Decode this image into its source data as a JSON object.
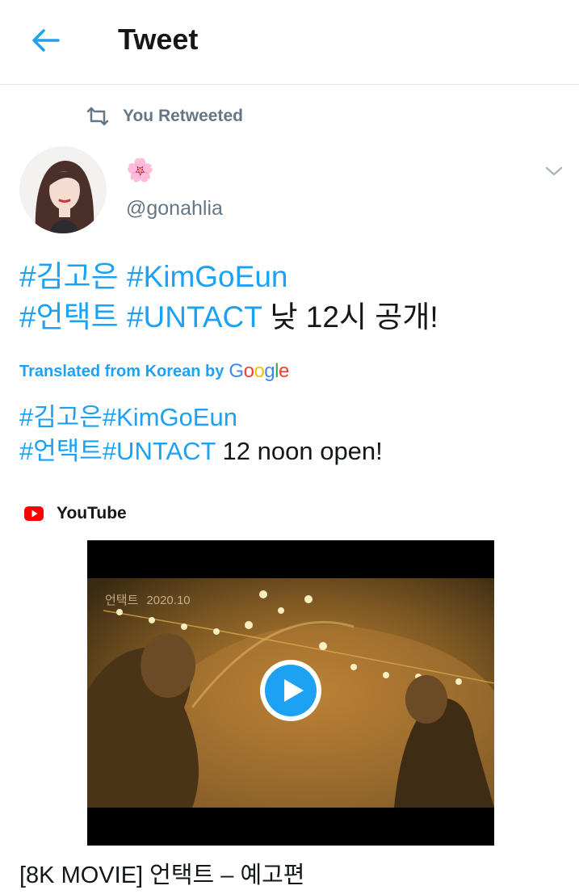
{
  "header": {
    "title": "Tweet",
    "back_icon": "arrow-left-icon"
  },
  "retweet": {
    "label": "You Retweeted",
    "icon": "retweet-icon"
  },
  "author": {
    "display_name": "🌸",
    "handle": "@gonahlia",
    "menu_icon": "chevron-down-icon"
  },
  "tweet": {
    "line1": {
      "tag1": "#김고은",
      "tag2": "#KimGoEun"
    },
    "line2": {
      "tag1": "#언택트",
      "tag2": "#UNTACT",
      "text": "낮 12시 공개!"
    }
  },
  "translation": {
    "label": "Translated from Korean by",
    "provider": "Google",
    "line1": {
      "tag1": "#김고은",
      "tag2": "#KimGoEun"
    },
    "line2": {
      "tag1": "#언택트",
      "tag2": "#UNTACT",
      "text": "12 noon open!"
    }
  },
  "card": {
    "source": "YouTube",
    "video_overlay": {
      "title": "언택트",
      "date": "2020.10"
    },
    "title": "[8K MOVIE] 언택트 – 예고편"
  },
  "colors": {
    "accent": "#1da1f2",
    "text": "#14171a",
    "muted": "#657786",
    "youtube": "#ff0000"
  }
}
